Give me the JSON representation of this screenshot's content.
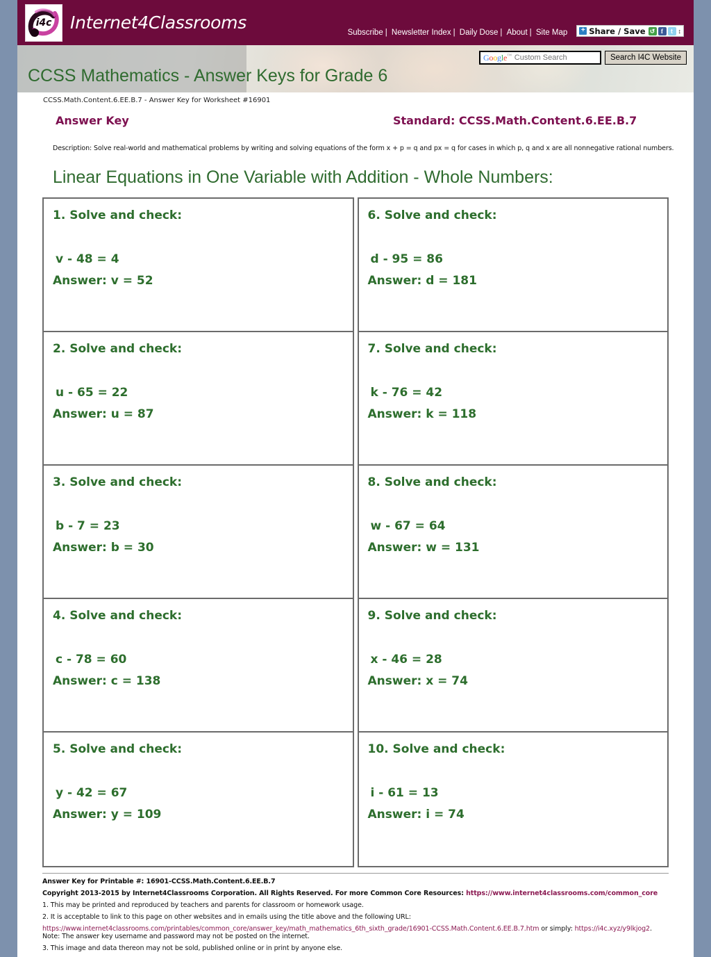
{
  "site": {
    "logo_text": "Internet4Classrooms",
    "logo_badge_text": "i4c",
    "nav": [
      {
        "label": "Subscribe"
      },
      {
        "label": "Newsletter Index"
      },
      {
        "label": "Daily Dose"
      },
      {
        "label": "About"
      },
      {
        "label": "Site Map"
      }
    ],
    "share": {
      "plus": "+",
      "label": "Share / Save",
      "icons": [
        "share-icon",
        "facebook-icon",
        "twitter-icon"
      ],
      "caret": "↕"
    },
    "search": {
      "brand": "Google",
      "tm": "™",
      "placeholder": "Custom Search",
      "button": "Search I4C Website"
    }
  },
  "banner": {
    "title": "CCSS Mathematics - Answer Keys for Grade 6"
  },
  "sheet": {
    "worksheet_id": "CCSS.Math.Content.6.EE.B.7 - Answer Key for Worksheet #16901",
    "answer_key_label": "Answer Key",
    "standard_label": "Standard: CCSS.Math.Content.6.EE.B.7",
    "description": "Description: Solve real-world and mathematical problems by writing and solving equations of the form x + p = q and px = q for cases in which p, q and x are all nonnegative rational numbers.",
    "heading": "Linear Equations in One Variable with Addition - Whole Numbers:"
  },
  "problems": {
    "left": [
      {
        "title": "1. Solve and check:",
        "equation": "v - 48 = 4",
        "answer": "Answer: v = 52"
      },
      {
        "title": "2. Solve and check:",
        "equation": "u - 65 = 22",
        "answer": "Answer: u = 87"
      },
      {
        "title": "3. Solve and check:",
        "equation": "b - 7 = 23",
        "answer": "Answer: b = 30"
      },
      {
        "title": "4. Solve and check:",
        "equation": "c - 78 = 60",
        "answer": "Answer: c = 138"
      },
      {
        "title": "5. Solve and check:",
        "equation": "y - 42 = 67",
        "answer": "Answer: y = 109"
      }
    ],
    "right": [
      {
        "title": "6. Solve and check:",
        "equation": "d - 95 = 86",
        "answer": "Answer: d = 181"
      },
      {
        "title": "7. Solve and check:",
        "equation": "k - 76 = 42",
        "answer": "Answer: k = 118"
      },
      {
        "title": "8. Solve and check:",
        "equation": "w - 67 = 64",
        "answer": "Answer: w = 131"
      },
      {
        "title": "9. Solve and check:",
        "equation": "x - 46 = 28",
        "answer": "Answer: x = 74"
      },
      {
        "title": "10. Solve and check:",
        "equation": "i - 61 = 13",
        "answer": "Answer: i = 74"
      }
    ]
  },
  "footer": {
    "printable_line": "Answer Key for Printable #: 16901-CCSS.Math.Content.6.EE.B.7",
    "copyright_pre": "Copyright 2013-2015 by Internet4Classrooms Corporation. All Rights Reserved. For more Common Core Resources: ",
    "copyright_link": "https://www.internet4classrooms.com/common_core",
    "item1": "1. This may be printed and reproduced by teachers and parents for classroom or homework usage.",
    "item2": "2. It is acceptable to link to this page on other websites and in emails using the title above and the following URL:",
    "long_url": "https://www.internet4classrooms.com/printables/common_core/answer_key/math_mathematics_6th_sixth_grade/16901-CCSS.Math.Content.6.EE.B.7.htm",
    "or_simply": " or simply: ",
    "short_url": "https://i4c.xyz/y9lkjog2",
    "note": ". Note: The answer key username and password may not be posted on the internet.",
    "item3": "3. This image and data thereon may not be sold, published online or in print by anyone else."
  }
}
